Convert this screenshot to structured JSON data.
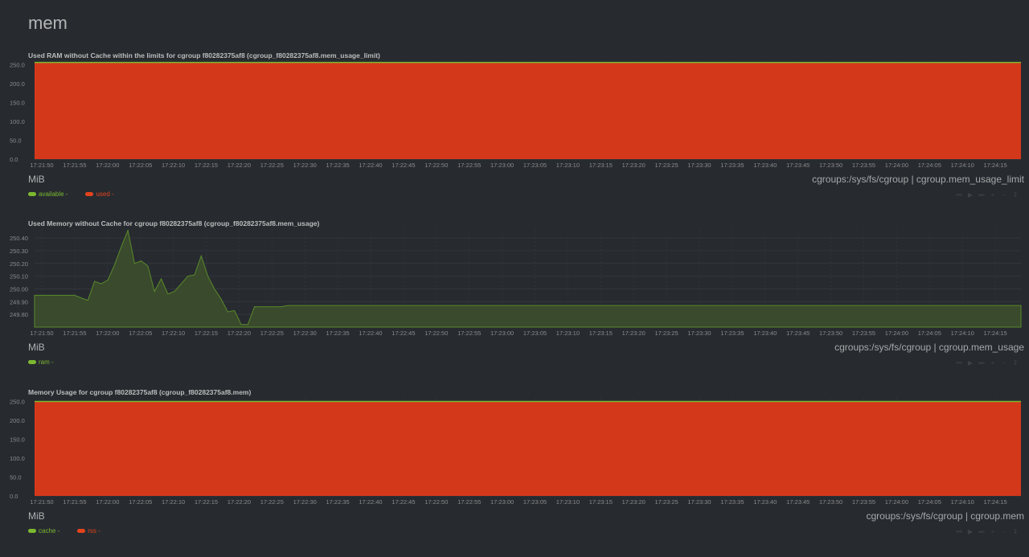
{
  "section": {
    "title": "mem"
  },
  "charts": [
    {
      "title": "Used RAM without Cache within the limits for cgroup f80282375af8 (cgroup_f80282375af8.mem_usage_limit)",
      "units": "MiB",
      "context": "cgroups:/sys/fs/cgroup | cgroup.mem_usage_limit",
      "legend": [
        {
          "name": "available",
          "value": "-",
          "color": "#7cb82f"
        },
        {
          "name": "used",
          "value": "-",
          "color": "#e5431c"
        }
      ]
    },
    {
      "title": "Used Memory without Cache for cgroup f80282375af8 (cgroup_f80282375af8.mem_usage)",
      "units": "MiB",
      "context": "cgroups:/sys/fs/cgroup | cgroup.mem_usage",
      "legend": [
        {
          "name": "ram",
          "value": "-",
          "color": "#7cb82f"
        }
      ]
    },
    {
      "title": "Memory Usage for cgroup f80282375af8 (cgroup_f80282375af8.mem)",
      "units": "MiB",
      "context": "cgroups:/sys/fs/cgroup | cgroup.mem",
      "legend": [
        {
          "name": "cache",
          "value": "-",
          "color": "#7cb82f"
        },
        {
          "name": "rss",
          "value": "-",
          "color": "#e5431c"
        }
      ]
    }
  ],
  "toolbar": {
    "icons": [
      "step-back-icon",
      "play-icon",
      "step-forward-icon",
      "zoom-in-icon",
      "zoom-out-icon",
      "resize-icon"
    ],
    "glyphs": [
      "⏮",
      "▶",
      "⏭",
      "+",
      "−",
      "⇕"
    ]
  },
  "chart_data": [
    {
      "type": "area",
      "title": "Used RAM without Cache within the limits for cgroup f80282375af8 (cgroup_f80282375af8.mem_usage_limit)",
      "ylabel": "MiB",
      "ylim": [
        0,
        260
      ],
      "yticks": [
        "250.0",
        "200.0",
        "150.0",
        "100.0",
        "50.0",
        "0.0"
      ],
      "x": [
        "17:21:50",
        "17:21:55",
        "17:22:00",
        "17:22:05",
        "17:22:10",
        "17:22:15",
        "17:22:20",
        "17:22:25",
        "17:22:30",
        "17:22:35",
        "17:22:40",
        "17:22:45",
        "17:22:50",
        "17:22:55",
        "17:23:00",
        "17:23:05",
        "17:23:10",
        "17:23:15",
        "17:23:20",
        "17:23:25",
        "17:23:30",
        "17:23:35",
        "17:23:40",
        "17:23:45",
        "17:23:50",
        "17:23:55",
        "17:24:00",
        "17:24:05",
        "17:24:10",
        "17:24:15"
      ],
      "series": [
        {
          "name": "used",
          "color": "#d4381a",
          "values": [
            256,
            256
          ]
        },
        {
          "name": "available",
          "color": "#7cb82f",
          "values": [
            2,
            2
          ]
        }
      ],
      "stacked": true
    },
    {
      "type": "area",
      "title": "Used Memory without Cache for cgroup f80282375af8 (cgroup_f80282375af8.mem_usage)",
      "ylabel": "MiB",
      "ylim": [
        249.7,
        250.47
      ],
      "yticks": [
        "250.40",
        "250.30",
        "250.20",
        "250.10",
        "250.00",
        "249.90",
        "249.80"
      ],
      "x": [
        "17:21:50",
        "17:21:55",
        "17:22:00",
        "17:22:05",
        "17:22:10",
        "17:22:15",
        "17:22:20",
        "17:22:25",
        "17:22:30",
        "17:22:35",
        "17:22:40",
        "17:22:45",
        "17:22:50",
        "17:22:55",
        "17:23:00",
        "17:23:05",
        "17:23:10",
        "17:23:15",
        "17:23:20",
        "17:23:25",
        "17:23:30",
        "17:23:35",
        "17:23:40",
        "17:23:45",
        "17:23:50",
        "17:23:55",
        "17:24:00",
        "17:24:05",
        "17:24:10",
        "17:24:15"
      ],
      "series": [
        {
          "name": "ram",
          "color": "#5a8a2a",
          "values": [
            249.95,
            249.95,
            249.95,
            249.95,
            249.95,
            249.95,
            249.95,
            249.93,
            249.91,
            250.06,
            250.04,
            250.07,
            250.19,
            250.33,
            250.46,
            250.2,
            250.22,
            250.18,
            249.98,
            250.08,
            249.96,
            249.98,
            250.04,
            250.1,
            250.11,
            250.26,
            250.1,
            250.0,
            249.92,
            249.82,
            249.83,
            249.72,
            249.72,
            249.86,
            249.86,
            249.86,
            249.86,
            249.86,
            249.87,
            249.87,
            249.87,
            249.87,
            249.87,
            249.87,
            249.87,
            249.87,
            249.87,
            249.87,
            249.87,
            249.87,
            249.87,
            249.87,
            249.87,
            249.87,
            249.87,
            249.87,
            249.87,
            249.87,
            249.87,
            249.87,
            249.87,
            249.87,
            249.87,
            249.87,
            249.87,
            249.87,
            249.87,
            249.87,
            249.87,
            249.87,
            249.87,
            249.87,
            249.87,
            249.87,
            249.87,
            249.87,
            249.87,
            249.87,
            249.87,
            249.87,
            249.87,
            249.87,
            249.87,
            249.87,
            249.87,
            249.87,
            249.87,
            249.87,
            249.87,
            249.87,
            249.87,
            249.87,
            249.87,
            249.87,
            249.87,
            249.87,
            249.87,
            249.87,
            249.87,
            249.87,
            249.87,
            249.87,
            249.87,
            249.87,
            249.87,
            249.87,
            249.87,
            249.87,
            249.87,
            249.87,
            249.87,
            249.87,
            249.87,
            249.87,
            249.87,
            249.87,
            249.87,
            249.87,
            249.87,
            249.87,
            249.87,
            249.87,
            249.87,
            249.87,
            249.87,
            249.87,
            249.87,
            249.87,
            249.87,
            249.87,
            249.87,
            249.87,
            249.87,
            249.87,
            249.87,
            249.87,
            249.87,
            249.87,
            249.87,
            249.87,
            249.87,
            249.87,
            249.87,
            249.87,
            249.87,
            249.87,
            249.87,
            249.87,
            249.87
          ]
        }
      ]
    },
    {
      "type": "area",
      "title": "Memory Usage for cgroup f80282375af8 (cgroup_f80282375af8.mem)",
      "ylabel": "MiB",
      "ylim": [
        0,
        260
      ],
      "yticks": [
        "250.0",
        "200.0",
        "150.0",
        "100.0",
        "50.0",
        "0.0"
      ],
      "x": [
        "17:21:50",
        "17:21:55",
        "17:22:00",
        "17:22:05",
        "17:22:10",
        "17:22:15",
        "17:22:20",
        "17:22:25",
        "17:22:30",
        "17:22:35",
        "17:22:40",
        "17:22:45",
        "17:22:50",
        "17:22:55",
        "17:23:00",
        "17:23:05",
        "17:23:10",
        "17:23:15",
        "17:23:20",
        "17:23:25",
        "17:23:30",
        "17:23:35",
        "17:23:40",
        "17:23:45",
        "17:23:50",
        "17:23:55",
        "17:24:00",
        "17:24:05",
        "17:24:10",
        "17:24:15"
      ],
      "series": [
        {
          "name": "rss",
          "color": "#d4381a",
          "values": [
            250,
            250
          ]
        },
        {
          "name": "cache",
          "color": "#7cb82f",
          "values": [
            2,
            2
          ]
        }
      ],
      "stacked": true
    }
  ]
}
